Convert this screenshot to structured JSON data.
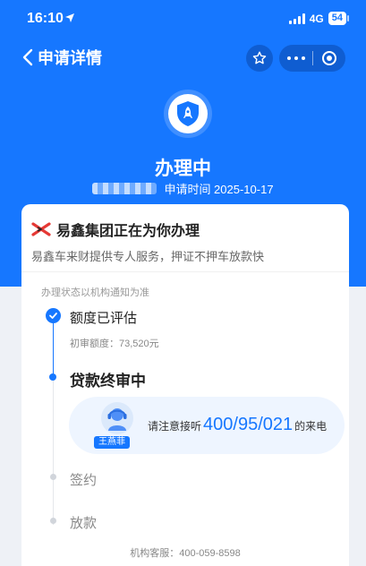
{
  "status_bar": {
    "time": "16:10",
    "network": "4G",
    "battery": "54"
  },
  "nav": {
    "title": "申请详情",
    "icons": [
      "chevron-left-icon",
      "star-icon",
      "more-icon",
      "target-icon"
    ]
  },
  "header": {
    "status_title": "办理中",
    "apply_time": "申请时间 2025-10-17",
    "icon": "rocket-shield-icon"
  },
  "card": {
    "org_title": "易鑫集团正在为你办理",
    "org_desc": "易鑫车来财提供专人服务，押证不押车放款快",
    "note": "办理状态以机构通知为准",
    "steps": [
      {
        "label": "额度已评估",
        "sub": "初审额度：73,520元",
        "state": "done"
      },
      {
        "label": "贷款终审中",
        "state": "active"
      },
      {
        "label": "签约",
        "state": "pending"
      },
      {
        "label": "放款",
        "state": "pending"
      }
    ],
    "call": {
      "agent_name": "王燕菲",
      "prefix": "请注意接听",
      "number": "400/95/021",
      "suffix": "的来电"
    },
    "service": "机构客服：400-059-8598"
  },
  "colors": {
    "primary": "#1677ff",
    "brand_red": "#e53935"
  }
}
